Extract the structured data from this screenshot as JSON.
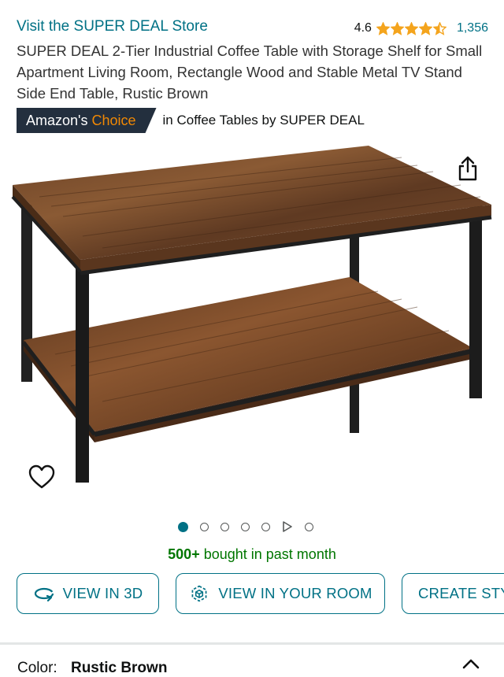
{
  "store": {
    "link_text": "Visit the SUPER DEAL Store"
  },
  "rating": {
    "value": "4.6",
    "stars": 4.5,
    "review_count": "1,356"
  },
  "product": {
    "title": "SUPER DEAL 2-Tier Industrial Coffee Table with Storage Shelf for Small Apartment Living Room, Rectangle Wood and Stable Metal TV Stand Side End Table, Rustic Brown"
  },
  "badge": {
    "prefix": "Amazon's",
    "highlight": "Choice",
    "category_text": "in Coffee Tables by SUPER DEAL"
  },
  "carousel": {
    "active_index": 0,
    "items": [
      "image",
      "image",
      "image",
      "image",
      "image",
      "video",
      "image"
    ]
  },
  "social_proof": {
    "count": "500+",
    "text": "bought in past month"
  },
  "actions": {
    "view_3d": "VIEW IN 3D",
    "view_room": "VIEW IN YOUR ROOM",
    "create_style": "CREATE STY"
  },
  "variation": {
    "label": "Color:",
    "value": "Rustic Brown"
  },
  "colors": {
    "link": "#007185",
    "star": "#f4a41d",
    "badge_bg": "#232f3e",
    "badge_accent": "#f08804",
    "green": "#007600"
  },
  "icons": {
    "share": "share-icon",
    "wishlist": "heart-icon",
    "collapse": "chevron-up-icon",
    "view_3d": "rotate-3d-icon",
    "view_room": "ar-cube-icon"
  }
}
